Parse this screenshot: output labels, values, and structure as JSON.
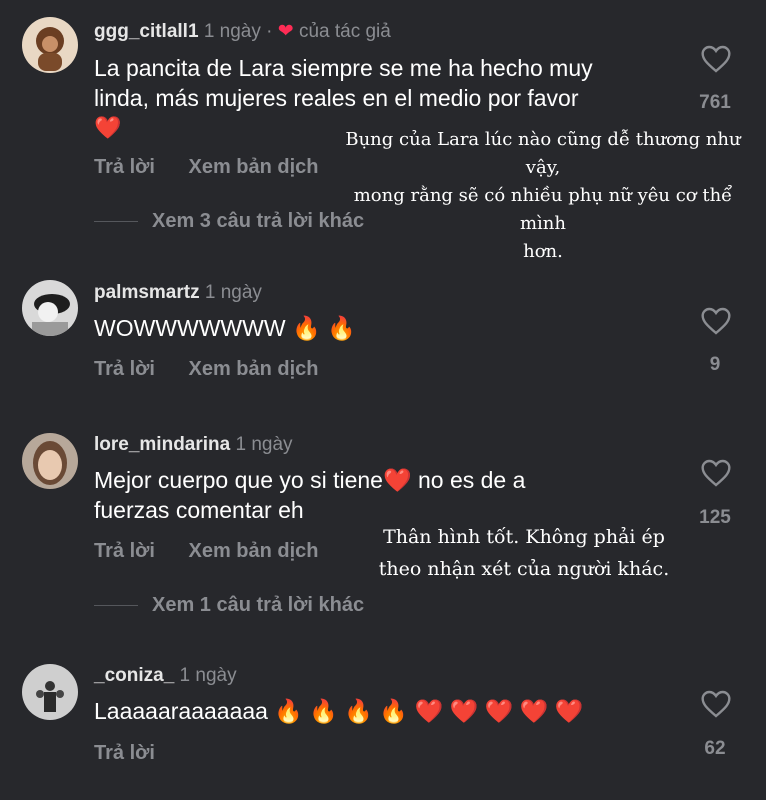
{
  "comments": [
    {
      "username": "ggg_citlall1",
      "time": "1 ngày ·",
      "author_liked": "của tác giả",
      "text_line1": "La pancita de Lara siempre se me ha hecho muy",
      "text_line2": "linda, más mujeres reales en el medio por favor",
      "text_line3": "❤️",
      "reply": "Trả lời",
      "translate": "Xem bản dịch",
      "likes": "761",
      "more_replies": "Xem 3 câu trả lời khác",
      "overlay": [
        "Bụng của Lara lúc nào cũng dễ thương như vậy,",
        "mong rằng sẽ có nhiều phụ nữ yêu cơ thể mình",
        "hơn."
      ]
    },
    {
      "username": "palmsmartz",
      "time": "1 ngày",
      "text_line1": "WOWWWWWWW 🔥 🔥",
      "reply": "Trả lời",
      "translate": "Xem bản dịch",
      "likes": "9"
    },
    {
      "username": "lore_mindarina",
      "time": "1 ngày",
      "text_line1": "Mejor cuerpo que yo si tiene❤️  no es de a",
      "text_line2": "fuerzas comentar eh",
      "reply": "Trả lời",
      "translate": "Xem bản dịch",
      "likes": "125",
      "more_replies": "Xem 1 câu trả lời khác",
      "overlay": [
        "Thân hình tốt. Không phải ép",
        "theo nhận xét của người khác."
      ]
    },
    {
      "username": "_coniza_",
      "time": "1 ngày",
      "text_line1": "Laaaaaraaaaaaa 🔥 🔥 🔥 🔥 ❤️ ❤️ ❤️ ❤️ ❤️",
      "reply": "Trả lời",
      "likes": "62"
    }
  ],
  "colors": {
    "background": "#27282c",
    "muted": "#8b8d92",
    "accent_heart": "#fe2c55"
  },
  "icons": {
    "like": "heart-outline-icon",
    "author_like": "heart-filled-icon"
  }
}
